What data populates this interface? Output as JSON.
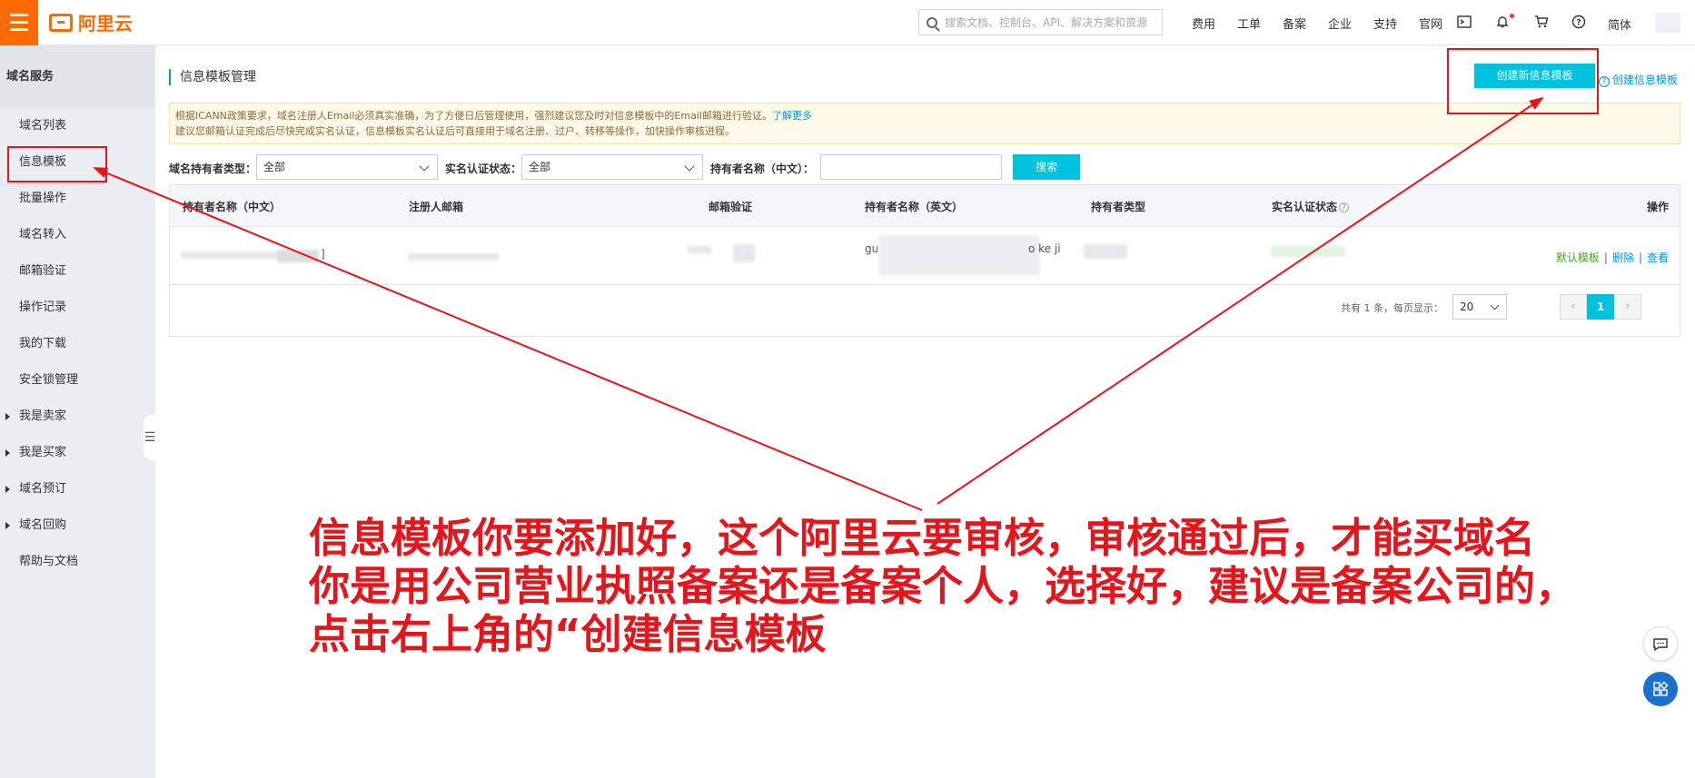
{
  "topbar": {
    "logo_text": "阿里云",
    "search_placeholder": "搜索文档、控制台、API、解决方案和资源",
    "nav": [
      "费用",
      "工单",
      "备案",
      "企业",
      "支持",
      "官网"
    ],
    "lang": "简体",
    "icons": [
      "terminal-icon",
      "bell-icon",
      "cart-icon",
      "help-icon"
    ]
  },
  "sidebar": {
    "title": "域名服务",
    "items": [
      {
        "label": "域名列表",
        "expandable": false
      },
      {
        "label": "信息模板",
        "expandable": false
      },
      {
        "label": "批量操作",
        "expandable": false
      },
      {
        "label": "域名转入",
        "expandable": false
      },
      {
        "label": "邮箱验证",
        "expandable": false
      },
      {
        "label": "操作记录",
        "expandable": false
      },
      {
        "label": "我的下载",
        "expandable": false
      },
      {
        "label": "安全锁管理",
        "expandable": false
      },
      {
        "label": "我是卖家",
        "expandable": true
      },
      {
        "label": "我是买家",
        "expandable": true
      },
      {
        "label": "域名预订",
        "expandable": true
      },
      {
        "label": "域名回购",
        "expandable": true
      },
      {
        "label": "帮助与文档",
        "expandable": false
      }
    ]
  },
  "main": {
    "title": "信息模板管理",
    "create_button": "创建新信息模板",
    "help_link": "创建信息模板",
    "notice_line1": "根据ICANN政策要求，域名注册人Email必须真实准确，为了方便日后管理使用，强烈建议您及时对信息模板中的Email邮箱进行验证。",
    "notice_link": "了解更多",
    "notice_line2": "建议您邮箱认证完成后尽快完成实名认证，信息模板实名认证后可直接用于域名注册、过户、转移等操作，加快操作审核进程。",
    "filters": {
      "holder_type_label": "域名持有者类型：",
      "holder_type_value": "全部",
      "verify_status_label": "实名认证状态：",
      "verify_status_value": "全部",
      "holder_name_label": "持有者名称（中文）：",
      "holder_name_value": "",
      "search_button": "搜索"
    },
    "table": {
      "columns": [
        "持有者名称（中文）",
        "注册人邮箱",
        "邮箱验证",
        "持有者名称（英文）",
        "持有者类型",
        "实名认证状态",
        "操作"
      ],
      "row": {
        "name_cn_tail": "]",
        "name_en_head": "gu",
        "name_en_tail": "o ke ji",
        "ops": [
          "默认模板",
          "删除",
          "查看"
        ]
      }
    },
    "pager": {
      "summary": "共有 1 条，每页显示：",
      "page_size": "20",
      "prev": "‹",
      "current": "1",
      "next": "›"
    }
  },
  "annotation": {
    "lines": [
      "信息模板你要添加好，这个阿里云要审核，审核通过后，才能买域名",
      "你是用公司营业执照备案还是备案个人，选择好，建议是备案公司的，",
      "点击右上角的“创建信息模板"
    ],
    "color": "#e4151b"
  },
  "colors": {
    "brand": "#ff6a00",
    "primary": "#00c1de",
    "link": "#0099dd",
    "success": "#44a51e"
  }
}
